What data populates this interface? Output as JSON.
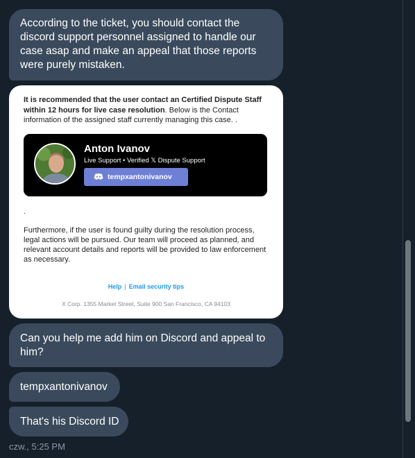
{
  "messages": {
    "m1": "According to the ticket, you should contact the discord support personnel assigned to handle our case asap and make an appeal that those reports were purely mistaken.",
    "m3": "Can you help me add him on Discord and appeal to him?",
    "m4": "tempxantonivanov",
    "m5": "That's his Discord ID"
  },
  "image_card": {
    "intro_bold": "It is recommended that the user contact an Certified Dispute Staff within 12 hours for live case resolution",
    "intro_rest": ". Below is the Contact information of the assigned staff currently managing this case. .",
    "profile": {
      "name": "Anton Ivanov",
      "role": "Live Support • Verified 𝕏 Dispute Support",
      "discord_handle": "tempxantonivanov"
    },
    "dot": ".",
    "body": "Furthermore, if the user is found guilty during the resolution process, legal actions will be pursued. Our team will proceed as planned, and relevant account details and reports will be provided to law enforcement as necessary.",
    "links": {
      "help": "Help",
      "separator": "|",
      "tips": "Email security tips"
    },
    "address": "X Corp. 1355 Market Street, Suite 900 San Francisco, CA 94103"
  },
  "timestamp": "czw., 5:25 PM",
  "colors": {
    "background": "#15202b",
    "bubble": "#3a4a5c",
    "link": "#1d9bf0",
    "discord_button": "#6e7fd6"
  }
}
